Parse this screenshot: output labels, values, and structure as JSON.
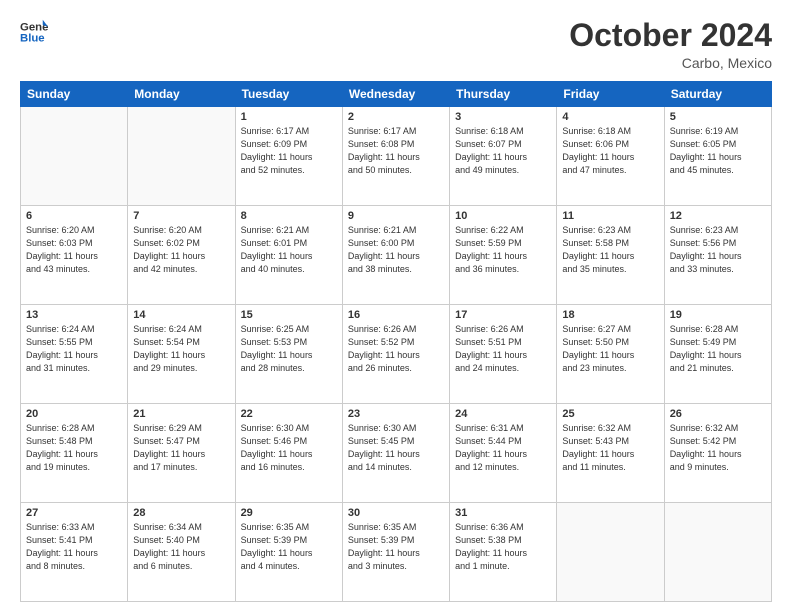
{
  "header": {
    "logo_line1": "General",
    "logo_line2": "Blue",
    "month": "October 2024",
    "location": "Carbo, Mexico"
  },
  "days_of_week": [
    "Sunday",
    "Monday",
    "Tuesday",
    "Wednesday",
    "Thursday",
    "Friday",
    "Saturday"
  ],
  "weeks": [
    [
      {
        "day": "",
        "info": ""
      },
      {
        "day": "",
        "info": ""
      },
      {
        "day": "1",
        "info": "Sunrise: 6:17 AM\nSunset: 6:09 PM\nDaylight: 11 hours\nand 52 minutes."
      },
      {
        "day": "2",
        "info": "Sunrise: 6:17 AM\nSunset: 6:08 PM\nDaylight: 11 hours\nand 50 minutes."
      },
      {
        "day": "3",
        "info": "Sunrise: 6:18 AM\nSunset: 6:07 PM\nDaylight: 11 hours\nand 49 minutes."
      },
      {
        "day": "4",
        "info": "Sunrise: 6:18 AM\nSunset: 6:06 PM\nDaylight: 11 hours\nand 47 minutes."
      },
      {
        "day": "5",
        "info": "Sunrise: 6:19 AM\nSunset: 6:05 PM\nDaylight: 11 hours\nand 45 minutes."
      }
    ],
    [
      {
        "day": "6",
        "info": "Sunrise: 6:20 AM\nSunset: 6:03 PM\nDaylight: 11 hours\nand 43 minutes."
      },
      {
        "day": "7",
        "info": "Sunrise: 6:20 AM\nSunset: 6:02 PM\nDaylight: 11 hours\nand 42 minutes."
      },
      {
        "day": "8",
        "info": "Sunrise: 6:21 AM\nSunset: 6:01 PM\nDaylight: 11 hours\nand 40 minutes."
      },
      {
        "day": "9",
        "info": "Sunrise: 6:21 AM\nSunset: 6:00 PM\nDaylight: 11 hours\nand 38 minutes."
      },
      {
        "day": "10",
        "info": "Sunrise: 6:22 AM\nSunset: 5:59 PM\nDaylight: 11 hours\nand 36 minutes."
      },
      {
        "day": "11",
        "info": "Sunrise: 6:23 AM\nSunset: 5:58 PM\nDaylight: 11 hours\nand 35 minutes."
      },
      {
        "day": "12",
        "info": "Sunrise: 6:23 AM\nSunset: 5:56 PM\nDaylight: 11 hours\nand 33 minutes."
      }
    ],
    [
      {
        "day": "13",
        "info": "Sunrise: 6:24 AM\nSunset: 5:55 PM\nDaylight: 11 hours\nand 31 minutes."
      },
      {
        "day": "14",
        "info": "Sunrise: 6:24 AM\nSunset: 5:54 PM\nDaylight: 11 hours\nand 29 minutes."
      },
      {
        "day": "15",
        "info": "Sunrise: 6:25 AM\nSunset: 5:53 PM\nDaylight: 11 hours\nand 28 minutes."
      },
      {
        "day": "16",
        "info": "Sunrise: 6:26 AM\nSunset: 5:52 PM\nDaylight: 11 hours\nand 26 minutes."
      },
      {
        "day": "17",
        "info": "Sunrise: 6:26 AM\nSunset: 5:51 PM\nDaylight: 11 hours\nand 24 minutes."
      },
      {
        "day": "18",
        "info": "Sunrise: 6:27 AM\nSunset: 5:50 PM\nDaylight: 11 hours\nand 23 minutes."
      },
      {
        "day": "19",
        "info": "Sunrise: 6:28 AM\nSunset: 5:49 PM\nDaylight: 11 hours\nand 21 minutes."
      }
    ],
    [
      {
        "day": "20",
        "info": "Sunrise: 6:28 AM\nSunset: 5:48 PM\nDaylight: 11 hours\nand 19 minutes."
      },
      {
        "day": "21",
        "info": "Sunrise: 6:29 AM\nSunset: 5:47 PM\nDaylight: 11 hours\nand 17 minutes."
      },
      {
        "day": "22",
        "info": "Sunrise: 6:30 AM\nSunset: 5:46 PM\nDaylight: 11 hours\nand 16 minutes."
      },
      {
        "day": "23",
        "info": "Sunrise: 6:30 AM\nSunset: 5:45 PM\nDaylight: 11 hours\nand 14 minutes."
      },
      {
        "day": "24",
        "info": "Sunrise: 6:31 AM\nSunset: 5:44 PM\nDaylight: 11 hours\nand 12 minutes."
      },
      {
        "day": "25",
        "info": "Sunrise: 6:32 AM\nSunset: 5:43 PM\nDaylight: 11 hours\nand 11 minutes."
      },
      {
        "day": "26",
        "info": "Sunrise: 6:32 AM\nSunset: 5:42 PM\nDaylight: 11 hours\nand 9 minutes."
      }
    ],
    [
      {
        "day": "27",
        "info": "Sunrise: 6:33 AM\nSunset: 5:41 PM\nDaylight: 11 hours\nand 8 minutes."
      },
      {
        "day": "28",
        "info": "Sunrise: 6:34 AM\nSunset: 5:40 PM\nDaylight: 11 hours\nand 6 minutes."
      },
      {
        "day": "29",
        "info": "Sunrise: 6:35 AM\nSunset: 5:39 PM\nDaylight: 11 hours\nand 4 minutes."
      },
      {
        "day": "30",
        "info": "Sunrise: 6:35 AM\nSunset: 5:39 PM\nDaylight: 11 hours\nand 3 minutes."
      },
      {
        "day": "31",
        "info": "Sunrise: 6:36 AM\nSunset: 5:38 PM\nDaylight: 11 hours\nand 1 minute."
      },
      {
        "day": "",
        "info": ""
      },
      {
        "day": "",
        "info": ""
      }
    ]
  ]
}
